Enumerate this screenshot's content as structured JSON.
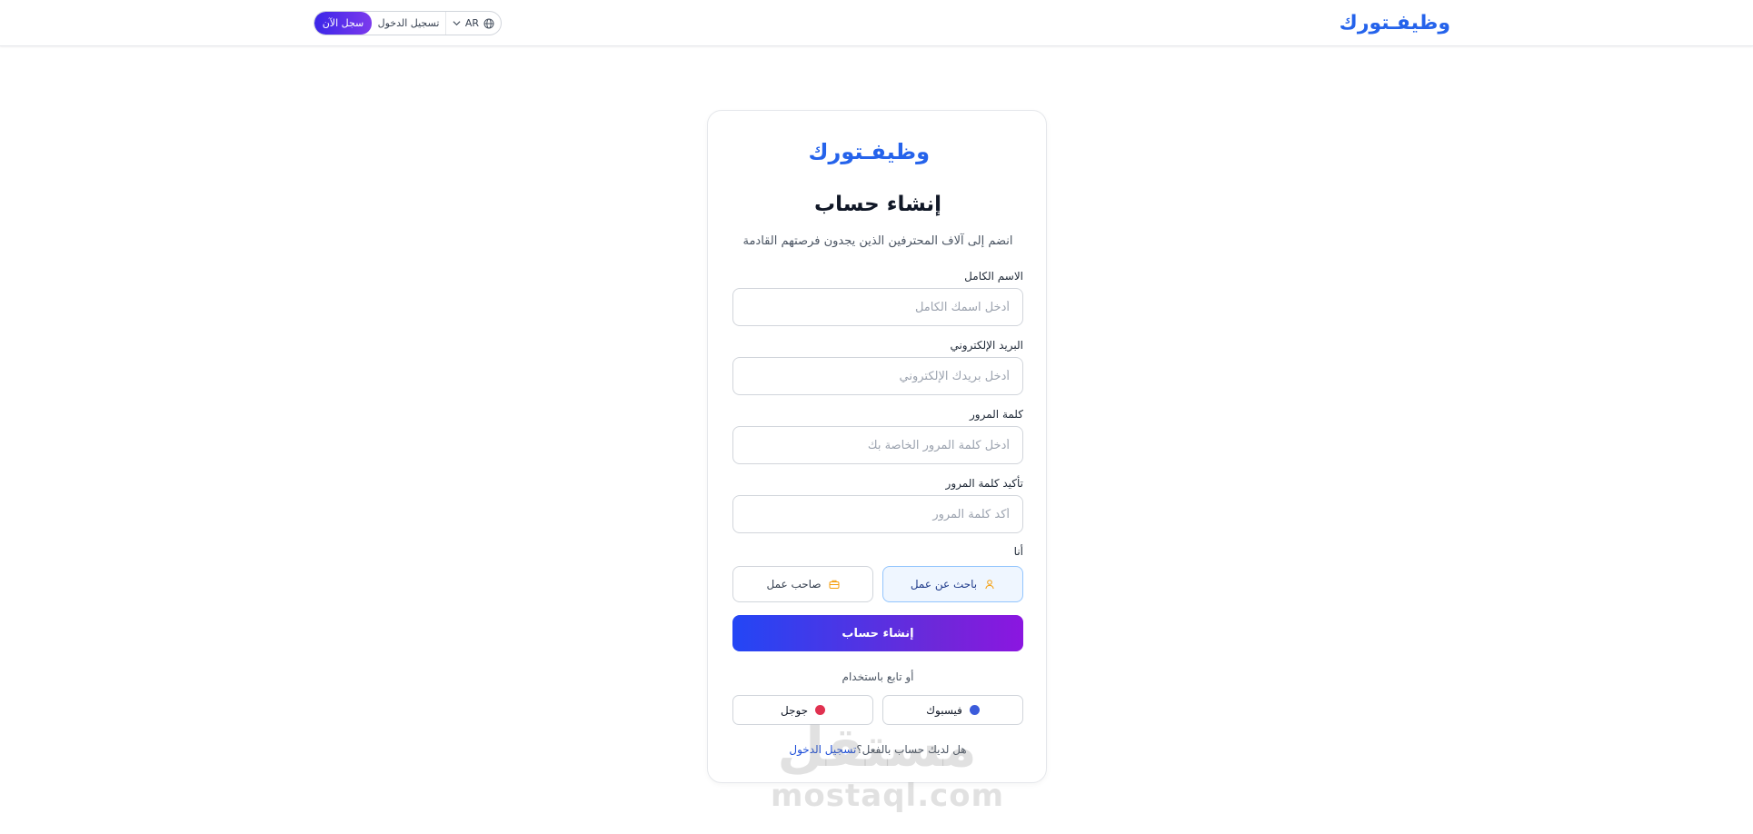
{
  "header": {
    "brand": "وظيفـتورك",
    "signup_label": "سجل الآن",
    "login_label": "تسجيل الدخول",
    "language": "AR"
  },
  "card": {
    "brand": "وظيفـتورك",
    "title": "إنشاء حساب",
    "subtitle": "انضم إلى آلاف المحترفين الذين يجدون فرصتهم القادمة",
    "fields": [
      {
        "label": "الاسم الكامل",
        "placeholder": "أدخل اسمك الكامل"
      },
      {
        "label": "البريد الإلكتروني",
        "placeholder": "أدخل بريدك الإلكتروني"
      },
      {
        "label": "كلمة المرور",
        "placeholder": "أدخل كلمة المرور الخاصة بك"
      },
      {
        "label": "تأكيد كلمة المرور",
        "placeholder": "أكد كلمة المرور"
      }
    ],
    "role_label": "أنا",
    "roles": [
      {
        "label": "باحث عن عمل",
        "icon": "user-icon",
        "selected": true
      },
      {
        "label": "صاحب عمل",
        "icon": "briefcase-icon",
        "selected": false
      }
    ],
    "submit_label": "إنشاء حساب",
    "divider": "أو تابع باستخدام",
    "social": [
      {
        "label": "فيسبوك",
        "icon": "facebook-icon",
        "color": "#3b5bdb"
      },
      {
        "label": "جوجل",
        "icon": "google-icon",
        "color": "#e03150"
      }
    ],
    "footer_question": "هل لديك حساب بالفعل؟",
    "footer_link": "تسجيل الدخول"
  },
  "watermark": {
    "arabic": "مستقل",
    "latin": "mostaql.com"
  },
  "colors": {
    "brand": "#2563eb",
    "accent_start": "#2346f5",
    "accent_end": "#8b16e0"
  }
}
